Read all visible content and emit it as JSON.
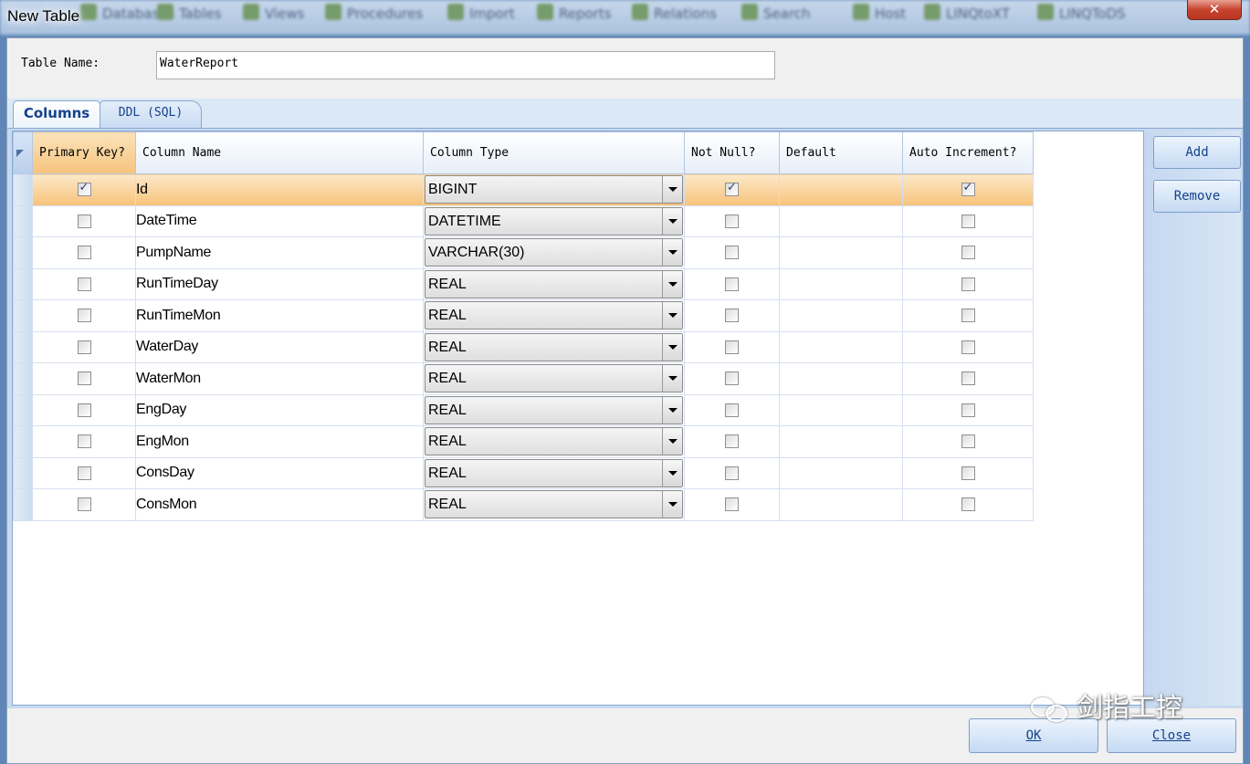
{
  "window": {
    "title": "New Table",
    "close_glyph": "✕"
  },
  "background_toolbar": [
    "Databases",
    "Tables",
    "Views",
    "Procedures",
    "Import",
    "Reports",
    "Relations",
    "Search",
    "Host",
    "LINQtoXT",
    "LINQToDS"
  ],
  "table_name": {
    "label": "Table Name:",
    "value": "WaterReport"
  },
  "tabs": [
    {
      "label": "Columns",
      "active": true
    },
    {
      "label": "DDL (SQL)",
      "active": false
    }
  ],
  "grid": {
    "headers": {
      "primary_key": "Primary Key?",
      "column_name": "Column Name",
      "column_type": "Column Type",
      "not_null": "Not Null?",
      "default": "Default",
      "auto_increment": "Auto Increment?"
    },
    "rows": [
      {
        "pk": true,
        "name": "Id",
        "type": "BIGINT",
        "not_null": true,
        "default": "",
        "auto_inc": true
      },
      {
        "pk": false,
        "name": "DateTime",
        "type": "DATETIME",
        "not_null": false,
        "default": "",
        "auto_inc": false
      },
      {
        "pk": false,
        "name": "PumpName",
        "type": "VARCHAR(30)",
        "not_null": false,
        "default": "",
        "auto_inc": false
      },
      {
        "pk": false,
        "name": "RunTimeDay",
        "type": "REAL",
        "not_null": false,
        "default": "",
        "auto_inc": false
      },
      {
        "pk": false,
        "name": "RunTimeMon",
        "type": "REAL",
        "not_null": false,
        "default": "",
        "auto_inc": false
      },
      {
        "pk": false,
        "name": "WaterDay",
        "type": "REAL",
        "not_null": false,
        "default": "",
        "auto_inc": false
      },
      {
        "pk": false,
        "name": "WaterMon",
        "type": "REAL",
        "not_null": false,
        "default": "",
        "auto_inc": false
      },
      {
        "pk": false,
        "name": "EngDay",
        "type": "REAL",
        "not_null": false,
        "default": "",
        "auto_inc": false
      },
      {
        "pk": false,
        "name": "EngMon",
        "type": "REAL",
        "not_null": false,
        "default": "",
        "auto_inc": false
      },
      {
        "pk": false,
        "name": "ConsDay",
        "type": "REAL",
        "not_null": false,
        "default": "",
        "auto_inc": false
      },
      {
        "pk": false,
        "name": "ConsMon",
        "type": "REAL",
        "not_null": false,
        "default": "",
        "auto_inc": false
      }
    ],
    "selected_row": 0
  },
  "side_buttons": {
    "add": "Add",
    "remove": "Remove"
  },
  "footer": {
    "ok": "OK",
    "close": "Close"
  },
  "watermark": "剑指工控",
  "colors": {
    "selection": "#f7c27a",
    "accent": "#15428b",
    "panel": "#c8daf0"
  }
}
